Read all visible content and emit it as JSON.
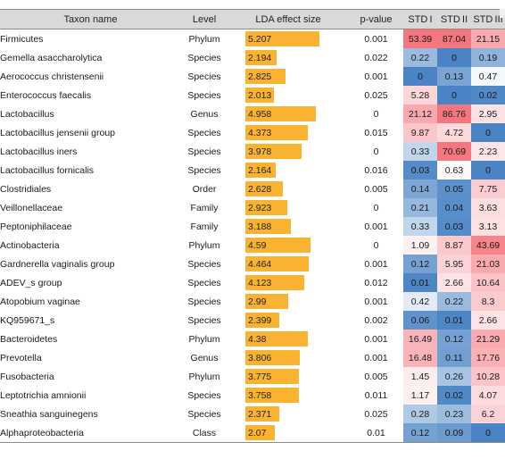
{
  "table": {
    "columns": [
      {
        "key": "taxon",
        "label": "Taxon name"
      },
      {
        "key": "level",
        "label": "Level"
      },
      {
        "key": "lda",
        "label": "LDA effect size"
      },
      {
        "key": "pval",
        "label": "p-value"
      },
      {
        "key": "std1",
        "label": "STD I"
      },
      {
        "key": "std2",
        "label": "STD II"
      },
      {
        "key": "std3",
        "label": "STD III"
      }
    ],
    "lda_max": 5.207,
    "std_max": 87.04,
    "colors": {
      "header_bg": "#d9d9d9",
      "bar": "#f9b330",
      "heat_high": "#f4777f",
      "heat_low": "#4a84c4",
      "heat_mid": "#ffffff",
      "rule": "#8c8c8c"
    },
    "rows": [
      {
        "taxon": "Firmicutes",
        "level": "Phylum",
        "lda": "5.207",
        "pval": "0.001",
        "std1": "53.39",
        "std2": "87.04",
        "std3": "21.15"
      },
      {
        "taxon": "Gemella asaccharolytica",
        "level": "Species",
        "lda": "2.194",
        "pval": "0.022",
        "std1": "0.22",
        "std2": "0",
        "std3": "0.19"
      },
      {
        "taxon": "Aerococcus christensenii",
        "level": "Species",
        "lda": "2.825",
        "pval": "0.001",
        "std1": "0",
        "std2": "0.13",
        "std3": "0.47"
      },
      {
        "taxon": "Enterococcus faecalis",
        "level": "Species",
        "lda": "2.013",
        "pval": "0.025",
        "std1": "5.28",
        "std2": "0",
        "std3": "0.02"
      },
      {
        "taxon": "Lactobacillus",
        "level": "Genus",
        "lda": "4.958",
        "pval": "0",
        "std1": "21.12",
        "std2": "86.76",
        "std3": "2.95"
      },
      {
        "taxon": "Lactobacillus jensenii group",
        "level": "Species",
        "lda": "4.373",
        "pval": "0.015",
        "std1": "9.87",
        "std2": "4.72",
        "std3": "0"
      },
      {
        "taxon": "Lactobacillus iners",
        "level": "Species",
        "lda": "3.978",
        "pval": "0",
        "std1": "0.33",
        "std2": "70.69",
        "std3": "2.23"
      },
      {
        "taxon": "Lactobacillus fornicalis",
        "level": "Species",
        "lda": "2.164",
        "pval": "0.016",
        "std1": "0.03",
        "std2": "0.63",
        "std3": "0"
      },
      {
        "taxon": "Clostridiales",
        "level": "Order",
        "lda": "2.628",
        "pval": "0.005",
        "std1": "0.14",
        "std2": "0.05",
        "std3": "7.75"
      },
      {
        "taxon": "Veillonellaceae",
        "level": "Family",
        "lda": "2.923",
        "pval": "0",
        "std1": "0.21",
        "std2": "0.04",
        "std3": "3.63"
      },
      {
        "taxon": "Peptoniphilaceae",
        "level": "Family",
        "lda": "3.188",
        "pval": "0.001",
        "std1": "0.33",
        "std2": "0.03",
        "std3": "3.13"
      },
      {
        "taxon": "Actinobacteria",
        "level": "Phylum",
        "lda": "4.59",
        "pval": "0",
        "std1": "1.09",
        "std2": "8.87",
        "std3": "43.69"
      },
      {
        "taxon": "Gardnerella vaginalis group",
        "level": "Species",
        "lda": "4.464",
        "pval": "0.001",
        "std1": "0.12",
        "std2": "5.95",
        "std3": "21.03"
      },
      {
        "taxon": "ADEV_s group",
        "level": "Species",
        "lda": "4.123",
        "pval": "0.012",
        "std1": "0.01",
        "std2": "2.66",
        "std3": "10.64"
      },
      {
        "taxon": "Atopobium vaginae",
        "level": "Species",
        "lda": "2.99",
        "pval": "0.001",
        "std1": "0.42",
        "std2": "0.22",
        "std3": "8.3"
      },
      {
        "taxon": "KQ959671_s",
        "level": "Species",
        "lda": "2.399",
        "pval": "0.002",
        "std1": "0.06",
        "std2": "0.01",
        "std3": "2.66"
      },
      {
        "taxon": "Bacteroidetes",
        "level": "Phylum",
        "lda": "4.38",
        "pval": "0.001",
        "std1": "16.49",
        "std2": "0.12",
        "std3": "21.29"
      },
      {
        "taxon": "Prevotella",
        "level": "Genus",
        "lda": "3.806",
        "pval": "0.001",
        "std1": "16.48",
        "std2": "0.11",
        "std3": "17.76"
      },
      {
        "taxon": "Fusobacteria",
        "level": "Phylum",
        "lda": "3.775",
        "pval": "0.005",
        "std1": "1.45",
        "std2": "0.26",
        "std3": "10.28"
      },
      {
        "taxon": "Leptotrichia amnionii",
        "level": "Species",
        "lda": "3.758",
        "pval": "0.011",
        "std1": "1.17",
        "std2": "0.02",
        "std3": "4.07"
      },
      {
        "taxon": "Sneathia sanguinegens",
        "level": "Species",
        "lda": "2.371",
        "pval": "0.025",
        "std1": "0.28",
        "std2": "0.23",
        "std3": "6.2"
      },
      {
        "taxon": "Alphaproteobacteria",
        "level": "Class",
        "lda": "2.07",
        "pval": "0.01",
        "std1": "0.12",
        "std2": "0.09",
        "std3": "0"
      }
    ]
  }
}
